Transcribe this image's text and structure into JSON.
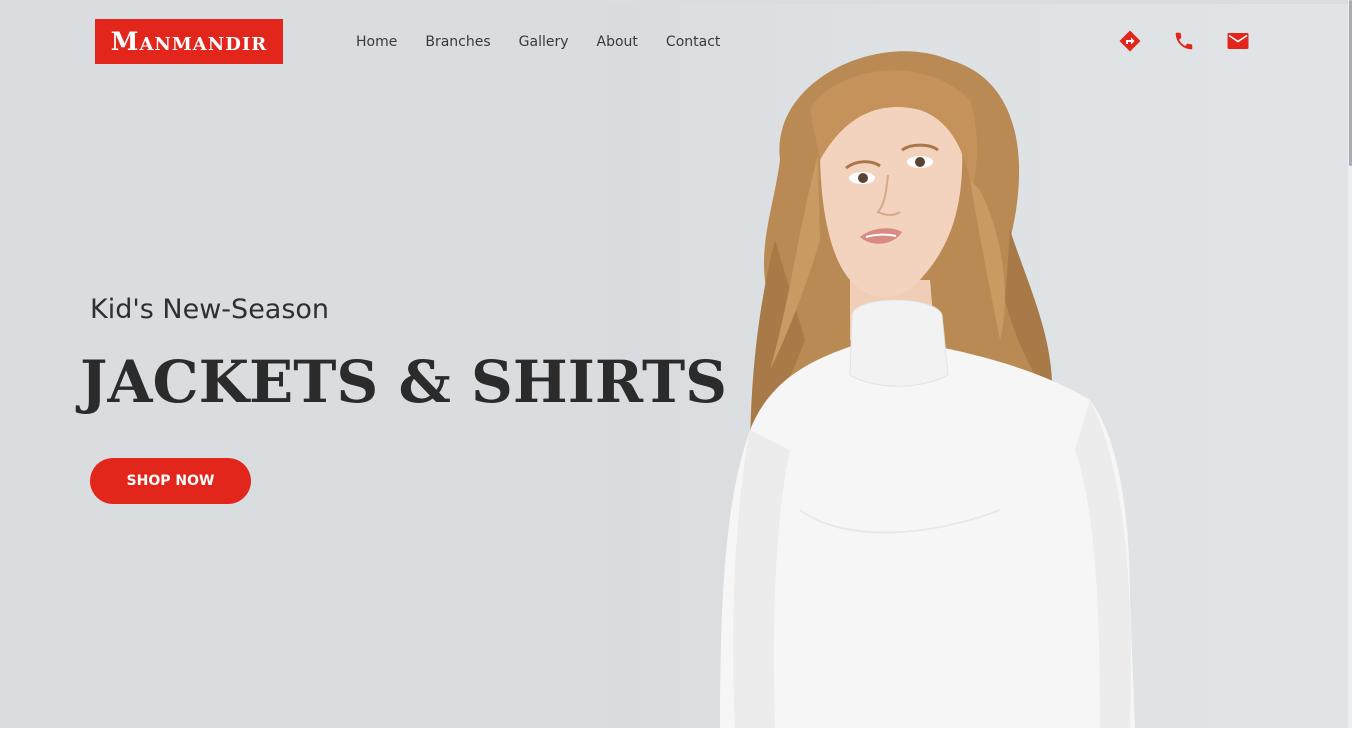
{
  "brand": {
    "logo_text": "Manmandir",
    "accent_color": "#e3261c"
  },
  "nav": {
    "items": [
      {
        "label": "Home"
      },
      {
        "label": "Branches"
      },
      {
        "label": "Gallery"
      },
      {
        "label": "About"
      },
      {
        "label": "Contact"
      }
    ]
  },
  "header_icons": [
    {
      "icon": "directions-icon"
    },
    {
      "icon": "phone-icon"
    },
    {
      "icon": "mail-icon"
    }
  ],
  "hero": {
    "subtitle": "Kid's New-Season",
    "headline": "JACKETS & SHIRTS",
    "cta_label": "SHOP NOW",
    "background_color": "#d9dde0",
    "image": "model-in-white-turtleneck"
  }
}
